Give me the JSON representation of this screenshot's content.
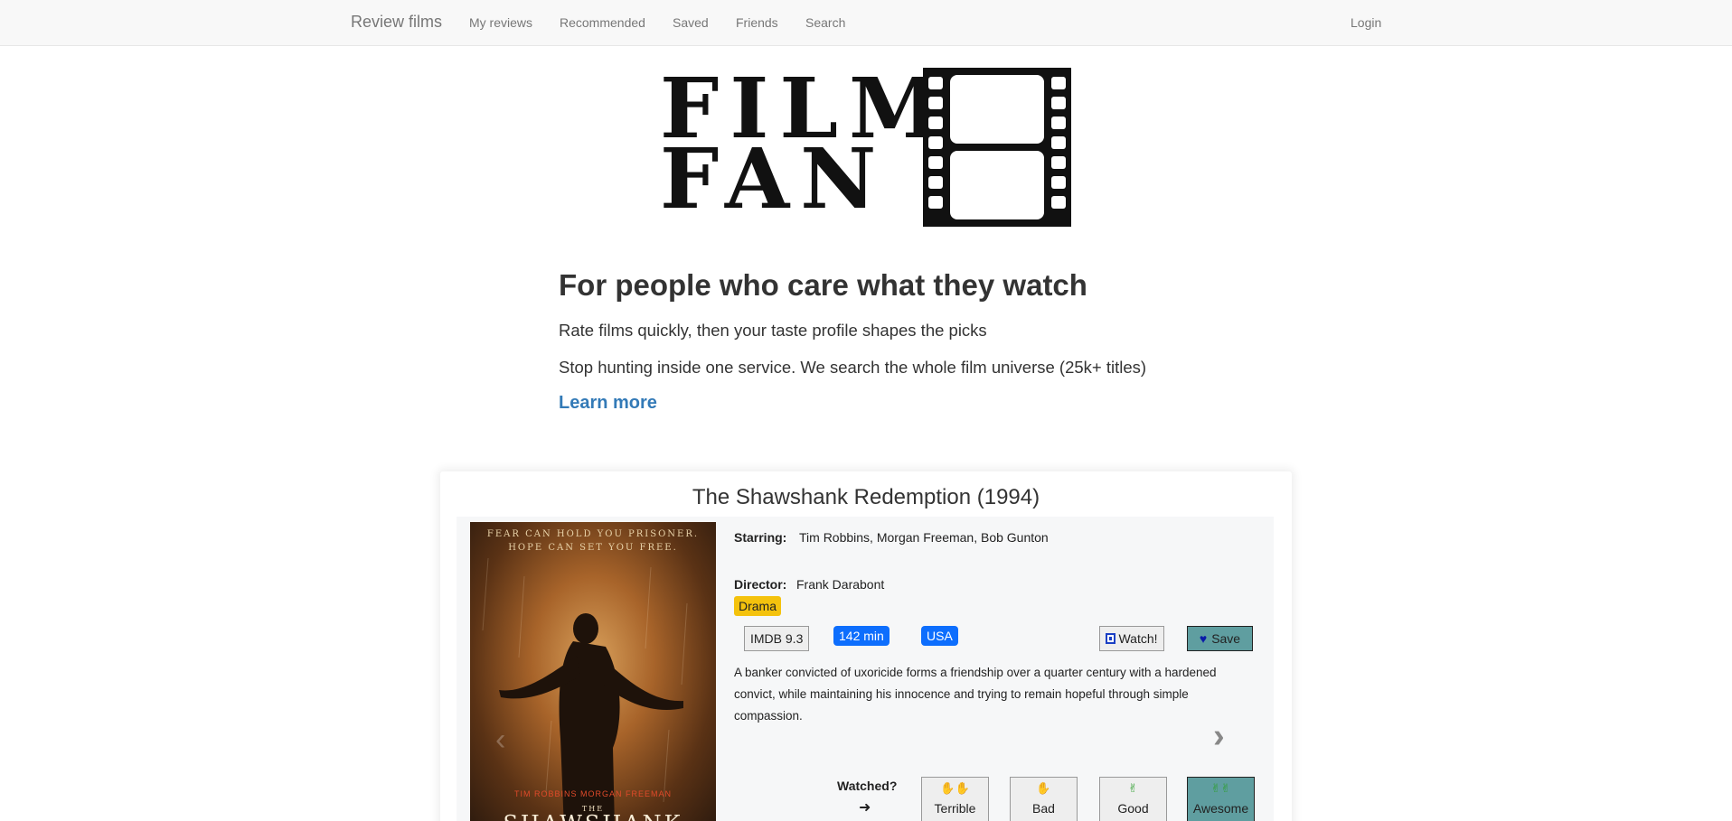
{
  "nav": {
    "brand": "Review films",
    "links": [
      "My reviews",
      "Recommended",
      "Saved",
      "Friends",
      "Search"
    ],
    "login": "Login"
  },
  "logo": {
    "line1": "FILM",
    "line2": "FAN"
  },
  "hero": {
    "title": "For people who care what they watch",
    "line1": "Rate films quickly, then your taste profile shapes the picks",
    "line2": "Stop hunting inside one service. We search the whole film universe (25k+ titles)",
    "learn_more": "Learn more"
  },
  "film": {
    "title": "The Shawshank Redemption (1994)",
    "poster": {
      "tagline_1": "FEAR CAN HOLD YOU PRISONER.",
      "tagline_2": "HOPE CAN SET YOU FREE.",
      "names": "TIM ROBBINS     MORGAN FREEMAN",
      "the": "THE",
      "title": "SHAWSHANK"
    },
    "starring_label": "Starring:",
    "starring": "Tim Robbins, Morgan Freeman, Bob Gunton",
    "director_label": "Director:",
    "director": "Frank Darabont",
    "genre": "Drama",
    "imdb": "IMDB 9.3",
    "runtime": "142 min",
    "country": "USA",
    "watch_label": "Watch!",
    "save_label": "Save",
    "description": "A banker convicted of uxoricide forms a friendship over a quarter century with a hardened convict, while maintaining his innocence and trying to remain hopeful through simple compassion.",
    "watched_label": "Watched?",
    "ratings": [
      "Terrible",
      "Bad",
      "Good",
      "Awesome"
    ]
  },
  "colors": {
    "link": "#337ab7",
    "genre_badge": "#f4c20d",
    "blue_badge": "#0d6efd",
    "save_button": "#5f9ea0",
    "thumb_down": "#d9302c",
    "thumb_up": "#2e9e2e"
  },
  "icons": {
    "watch": "film-icon",
    "save": "heart-icon",
    "carousel_prev": "chevron-left-icon",
    "carousel_next": "chevron-right-icon",
    "arrow": "arrow-right-icon",
    "terrible": "double-thumbs-down-icon",
    "bad": "thumbs-down-icon",
    "good": "thumbs-up-icon",
    "awesome": "double-thumbs-up-icon"
  }
}
